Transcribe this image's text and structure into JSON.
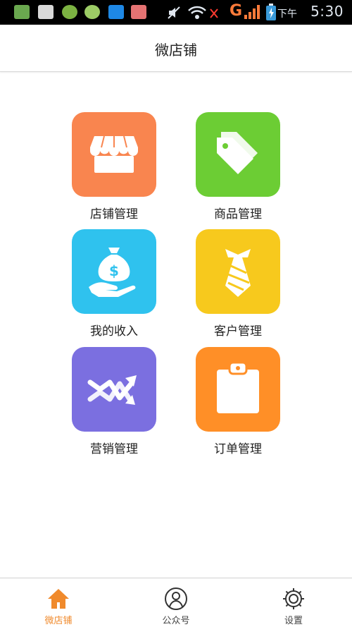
{
  "status_bar": {
    "time": "5:30",
    "am_pm": "下午",
    "network": "G"
  },
  "header": {
    "title": "微店铺"
  },
  "tiles": [
    {
      "label": "店铺管理",
      "icon": "store-icon",
      "color": "#f9854f"
    },
    {
      "label": "商品管理",
      "icon": "tag-icon",
      "color": "#6ccd34"
    },
    {
      "label": "我的收入",
      "icon": "money-bag-hand-icon",
      "color": "#2fc2ee"
    },
    {
      "label": "客户管理",
      "icon": "tie-icon",
      "color": "#f7c91d"
    },
    {
      "label": "营销管理",
      "icon": "trend-arrows-icon",
      "color": "#7b6fe0"
    },
    {
      "label": "订单管理",
      "icon": "clipboard-icon",
      "color": "#ff8f27"
    }
  ],
  "bottom_nav": [
    {
      "label": "微店铺",
      "icon": "home-icon",
      "active": true
    },
    {
      "label": "公众号",
      "icon": "user-circle-icon",
      "active": false
    },
    {
      "label": "设置",
      "icon": "gear-icon",
      "active": false
    }
  ],
  "colors": {
    "accent": "#f08a2c"
  }
}
